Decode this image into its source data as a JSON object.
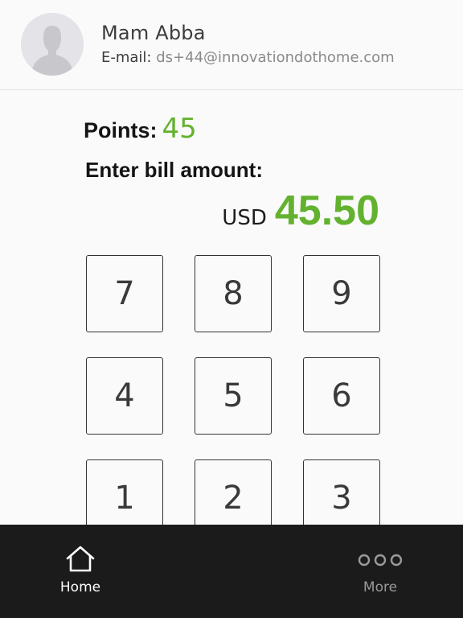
{
  "user": {
    "name": "Mam Abba",
    "email_label": "E-mail:",
    "email": "ds+44@innovationdothome.com",
    "avatar_icon": "user-silhouette-icon"
  },
  "points": {
    "label": "Points:",
    "value": "45"
  },
  "bill": {
    "label": "Enter bill amount:",
    "currency": "USD",
    "amount": "45.50"
  },
  "keypad": {
    "keys": [
      "7",
      "8",
      "9",
      "4",
      "5",
      "6",
      "1",
      "2",
      "3"
    ]
  },
  "tabbar": {
    "home": {
      "label": "Home",
      "icon": "home-icon"
    },
    "more": {
      "label": "More",
      "icon": "more-icon"
    }
  },
  "colors": {
    "accent_green": "#63b22f",
    "tabbar_bg": "#1b1b1b"
  }
}
